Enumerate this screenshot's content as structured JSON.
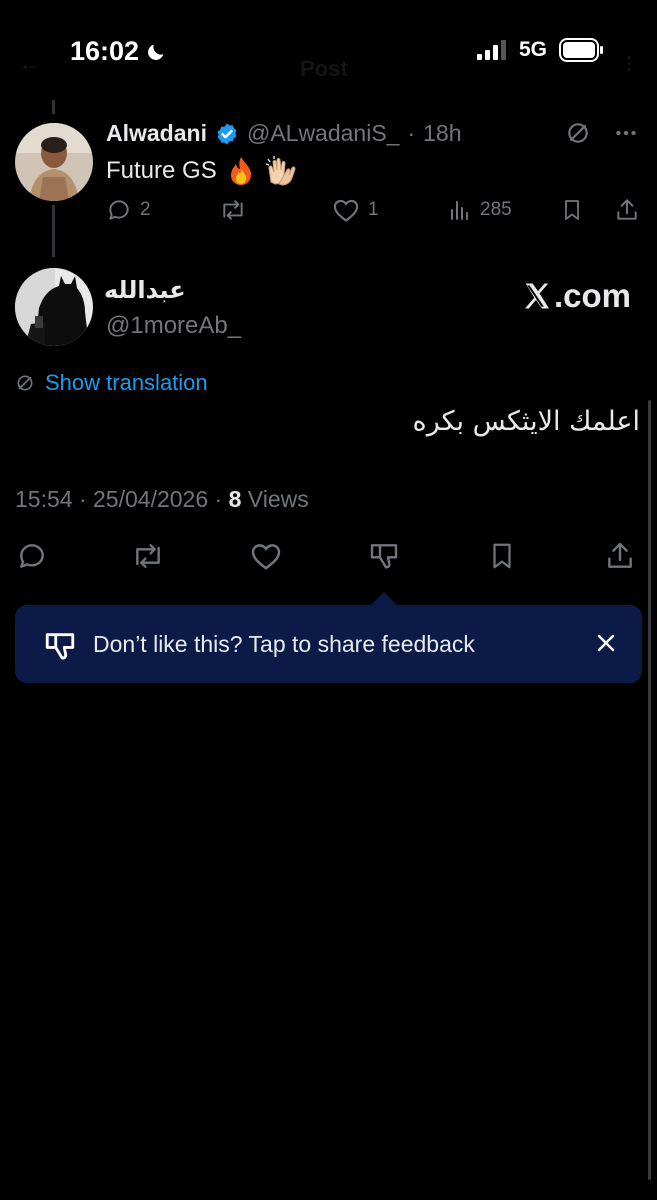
{
  "status_bar": {
    "time": "16:02",
    "network": "5G",
    "ghost_title": "Post"
  },
  "parent_tweet": {
    "name": "Alwadani",
    "handle": "@ALwadaniS_",
    "separator": "·",
    "time": "18h",
    "text": "Future GS",
    "emojis": [
      "fire",
      "clapping-hands"
    ],
    "replies": "2",
    "likes": "1",
    "views": "285"
  },
  "main_tweet": {
    "name": "عبدالله",
    "handle": "@1moreAb_",
    "watermark_suffix": ".com",
    "show_translation": "Show translation",
    "text": "اعلمك الايثكس بكره",
    "time": "15:54",
    "date": "25/04/2026",
    "meta_separator": "·",
    "views_count": "8",
    "views_label": "Views"
  },
  "feedback_banner": {
    "text": "Don’t like this? Tap to share feedback"
  },
  "colors": {
    "background": "#000000",
    "text_primary": "#e7e9ea",
    "text_secondary": "#71767b",
    "accent": "#1d9bf0",
    "banner_bg": "#0b1a46",
    "verified": "#1d9bf0"
  }
}
